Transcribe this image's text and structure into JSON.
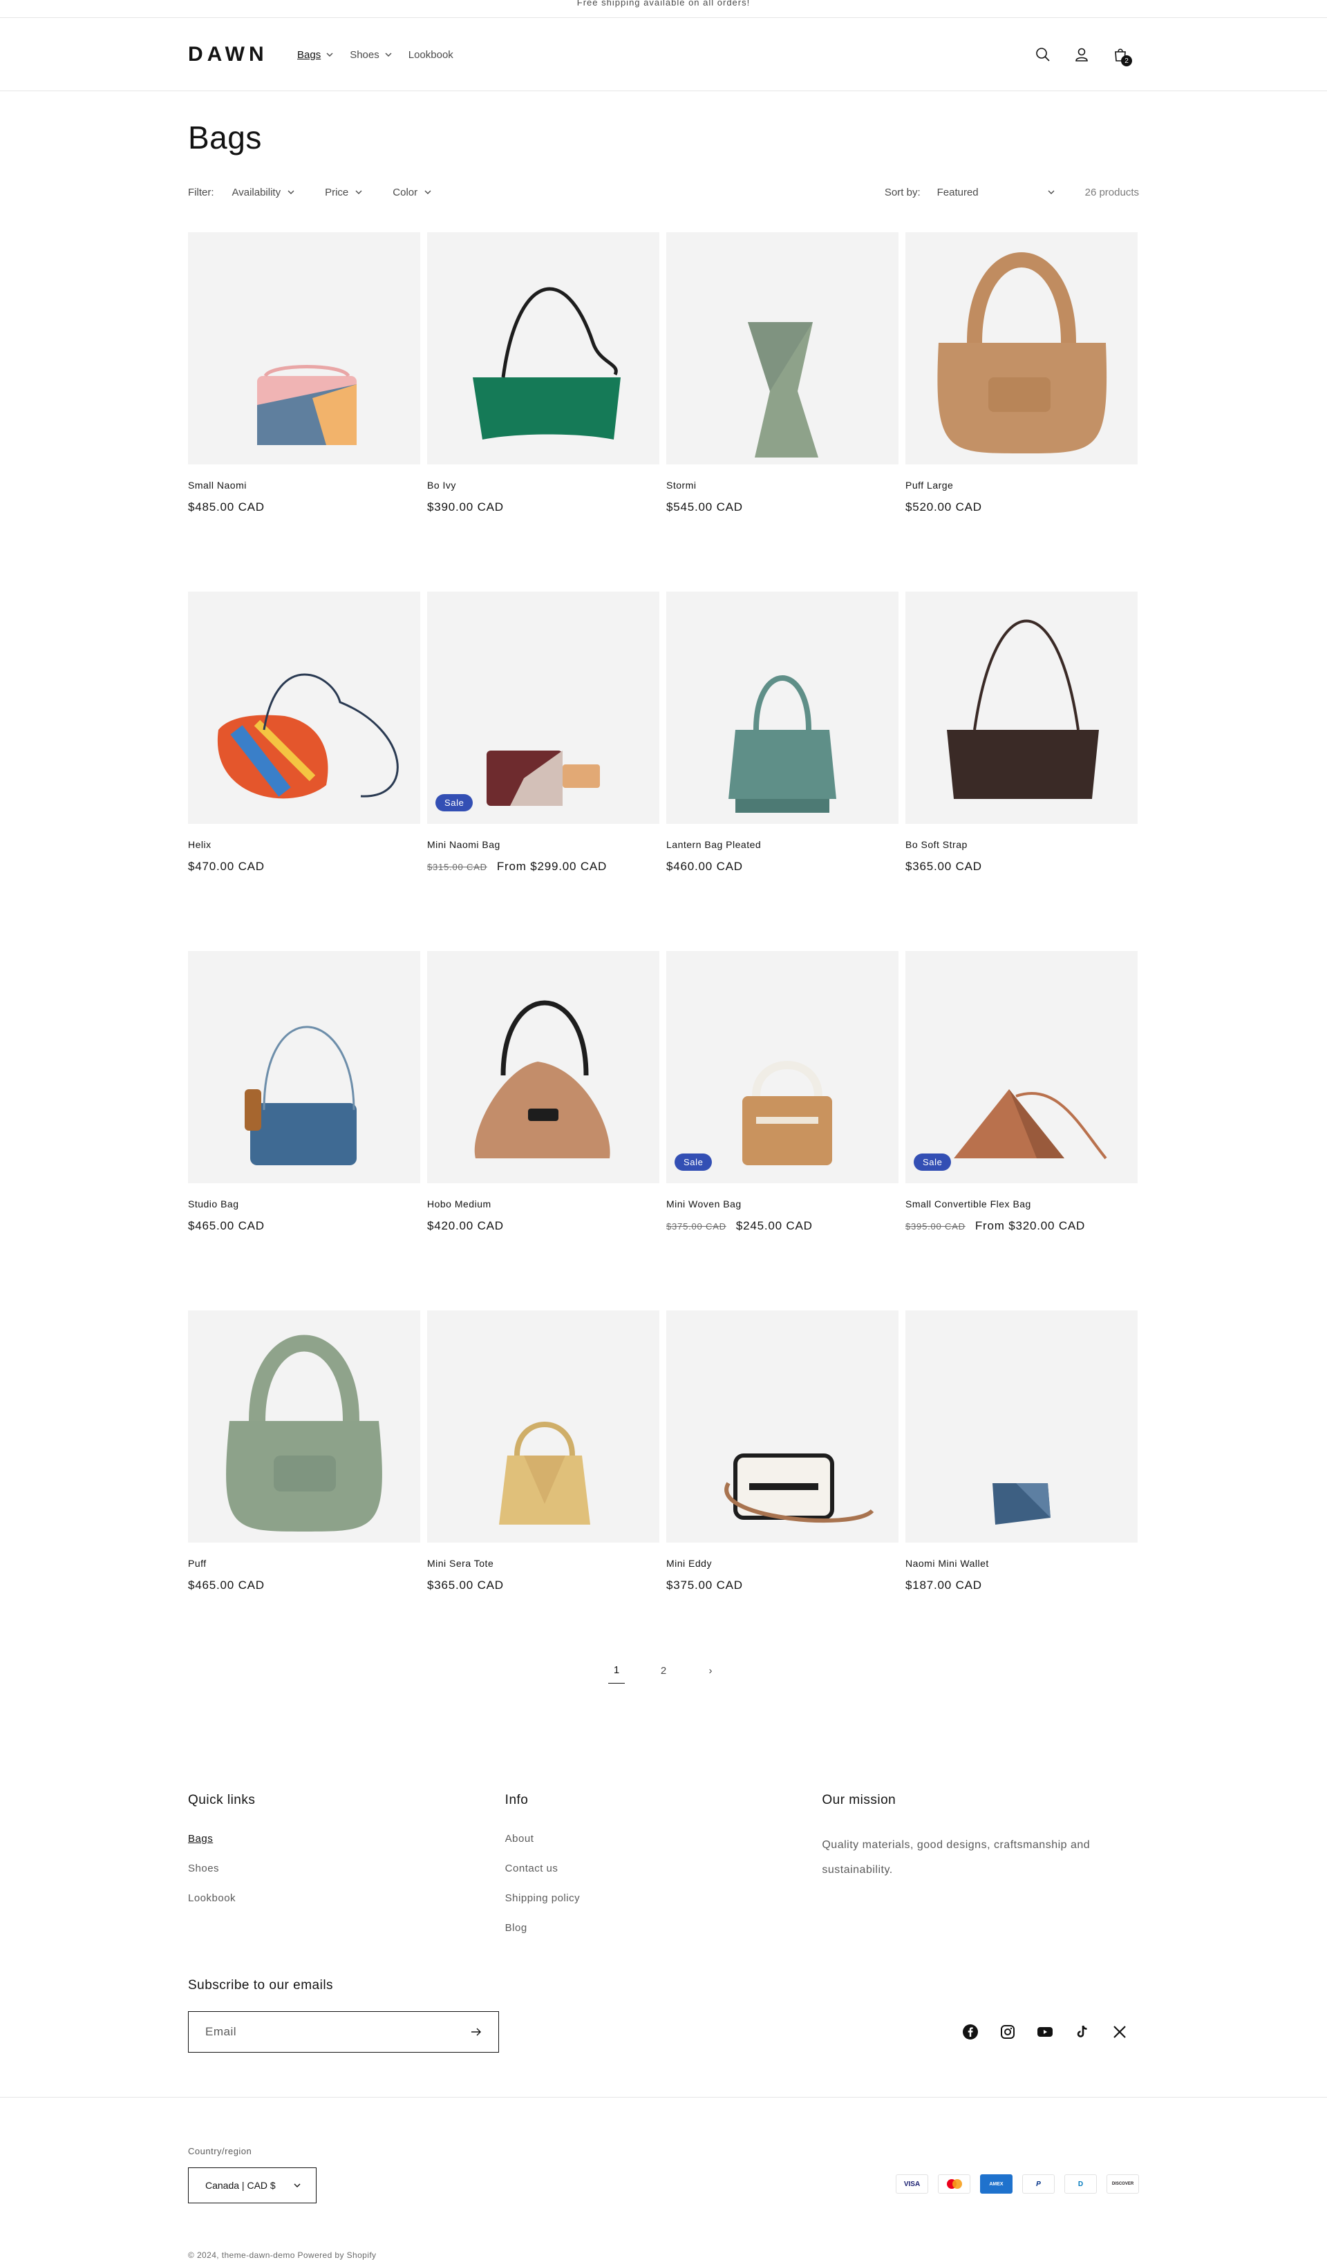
{
  "announcement": "Free shipping available on all orders!",
  "header": {
    "logo": "DAWN",
    "nav": [
      {
        "label": "Bags"
      },
      {
        "label": "Shoes"
      },
      {
        "label": "Lookbook"
      }
    ],
    "cart_count": "2"
  },
  "collection": {
    "title": "Bags",
    "filter_label": "Filter:",
    "facets": [
      "Availability",
      "Price",
      "Color"
    ],
    "sort_label": "Sort by:",
    "sort_value": "Featured",
    "product_count": "26 products"
  },
  "products": [
    {
      "title": "Small Naomi",
      "price": "$485.00 CAD"
    },
    {
      "title": "Bo Ivy",
      "price": "$390.00 CAD"
    },
    {
      "title": "Stormi",
      "price": "$545.00 CAD"
    },
    {
      "title": "Puff Large",
      "price": "$520.00 CAD"
    },
    {
      "title": "Helix",
      "price": "$470.00 CAD"
    },
    {
      "title": "Mini Naomi Bag",
      "old_price": "$315.00 CAD",
      "price": "From $299.00 CAD",
      "badge": "Sale"
    },
    {
      "title": "Lantern Bag Pleated",
      "price": "$460.00 CAD"
    },
    {
      "title": "Bo Soft Strap",
      "price": "$365.00 CAD"
    },
    {
      "title": "Studio Bag",
      "price": "$465.00 CAD"
    },
    {
      "title": "Hobo Medium",
      "price": "$420.00 CAD"
    },
    {
      "title": "Mini Woven Bag",
      "old_price": "$375.00 CAD",
      "price": "$245.00 CAD",
      "badge": "Sale"
    },
    {
      "title": "Small Convertible Flex Bag",
      "old_price": "$395.00 CAD",
      "price": "From $320.00 CAD",
      "badge": "Sale"
    },
    {
      "title": "Puff",
      "price": "$465.00 CAD"
    },
    {
      "title": "Mini Sera Tote",
      "price": "$365.00 CAD"
    },
    {
      "title": "Mini Eddy",
      "price": "$375.00 CAD"
    },
    {
      "title": "Naomi Mini Wallet",
      "price": "$187.00 CAD"
    }
  ],
  "pagination": {
    "pages": [
      "1",
      "2"
    ],
    "current": "1",
    "next": "›"
  },
  "footer": {
    "quick_links_title": "Quick links",
    "quick_links": [
      "Bags",
      "Shoes",
      "Lookbook"
    ],
    "info_title": "Info",
    "info_links": [
      "About",
      "Contact us",
      "Shipping policy",
      "Blog"
    ],
    "mission_title": "Our mission",
    "mission_text": "Quality materials, good designs, craftsmanship and sustainability.",
    "subscribe_title": "Subscribe to our emails",
    "email_placeholder": "Email",
    "social": [
      "facebook-icon",
      "instagram-icon",
      "youtube-icon",
      "tiktok-icon",
      "x-icon"
    ],
    "country_label": "Country/region",
    "country_value": "Canada | CAD $",
    "payments": [
      "VISA",
      "MC",
      "AMEX",
      "P",
      "D",
      "DISCOVER"
    ],
    "copyright": "© 2024, theme-dawn-demo Powered by Shopify"
  },
  "colors": {
    "sale_badge": "#334fb4",
    "card_bg": "#f3f3f3"
  }
}
